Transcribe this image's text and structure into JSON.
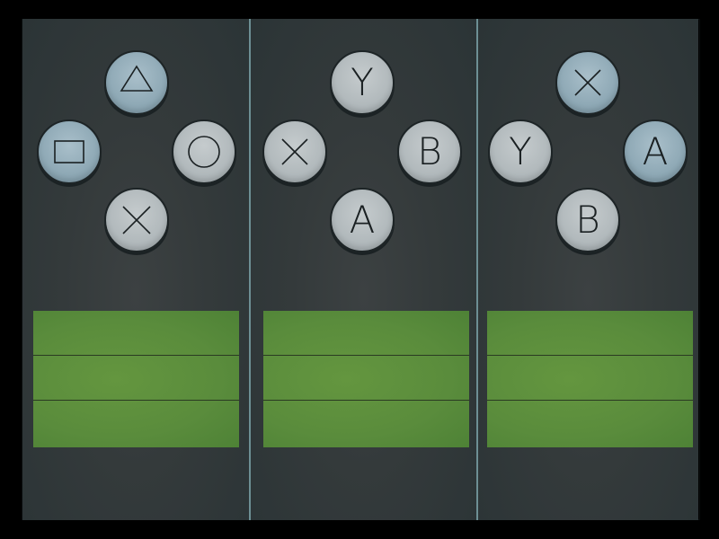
{
  "panels": [
    {
      "scheme": "playstation",
      "buttons": {
        "top": {
          "icon": "triangle-icon",
          "label": "",
          "color": "#8aa5b2"
        },
        "left": {
          "icon": "square-icon",
          "label": "",
          "color": "#8aa5b2"
        },
        "right": {
          "icon": "circle-icon",
          "label": "",
          "color": "#aeb6b9"
        },
        "bottom": {
          "icon": "cross-icon",
          "label": "",
          "color": "#aeb6b9"
        }
      },
      "slots": [
        "",
        "",
        ""
      ]
    },
    {
      "scheme": "xbox",
      "buttons": {
        "top": {
          "label": "Y",
          "color": "#aeb6b9"
        },
        "left": {
          "icon": "x-icon",
          "label": "",
          "color": "#aeb6b9"
        },
        "right": {
          "label": "B",
          "color": "#aeb6b9"
        },
        "bottom": {
          "label": "A",
          "color": "#aeb6b9"
        }
      },
      "slots": [
        "",
        "",
        ""
      ]
    },
    {
      "scheme": "nintendo",
      "buttons": {
        "top": {
          "icon": "x-icon",
          "label": "",
          "color": "#8aa5b2"
        },
        "left": {
          "label": "Y",
          "color": "#aeb6b9"
        },
        "right": {
          "label": "A",
          "color": "#8aa5b2"
        },
        "bottom": {
          "label": "B",
          "color": "#aeb6b9"
        }
      },
      "slots": [
        "",
        "",
        ""
      ]
    }
  ],
  "colors": {
    "background": "#000000",
    "panel": "#373d3e",
    "divider": "#6d8f94",
    "slot_green": "#5c8e3e",
    "button_silver": "#aeb6b9",
    "button_blue": "#8aa5b2"
  }
}
